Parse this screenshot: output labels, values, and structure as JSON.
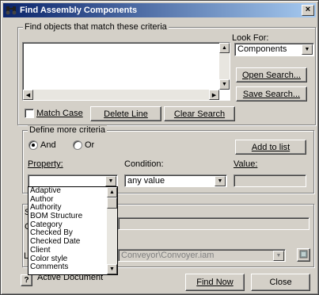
{
  "window": {
    "title": "Find Assembly Components",
    "close_glyph": "×"
  },
  "find_group": {
    "title": "Find objects that match these criteria",
    "look_for_label": "Look For:",
    "look_for_value": "Components",
    "match_case_label": "Match Case",
    "delete_line_label": "Delete Line",
    "clear_search_label": "Clear Search",
    "open_search_label": "Open Search...",
    "save_search_label": "Save Search..."
  },
  "criteria_group": {
    "title": "Define more criteria",
    "and_label": "And",
    "or_label": "Or",
    "selected": "And",
    "add_to_list_label": "Add to list",
    "property_label": "Property:",
    "condition_label": "Condition:",
    "value_label": "Value:",
    "property_value": "",
    "condition_value": "any value",
    "value_value": ""
  },
  "property_options": [
    "Adaptive",
    "Author",
    "Authority",
    "BOM Structure",
    "Category",
    "Checked By",
    "Checked Date",
    "Client",
    "Color style",
    "Comments"
  ],
  "lower_group": {
    "fragment_s": "S",
    "fragment_c": "C",
    "fragment_lc": "Lo",
    "location_value": "Conveyor\\Convoyer.iam",
    "active_document_label": "Active Document"
  },
  "footer": {
    "find_now_label": "Find Now",
    "close_label": "Close"
  },
  "icons": {
    "app": "binoculars-icon",
    "help": "help-icon",
    "browse": "browse-icon"
  },
  "colors": {
    "title_start": "#0a246a",
    "title_end": "#a6caf0",
    "face": "#d4d0c8"
  }
}
